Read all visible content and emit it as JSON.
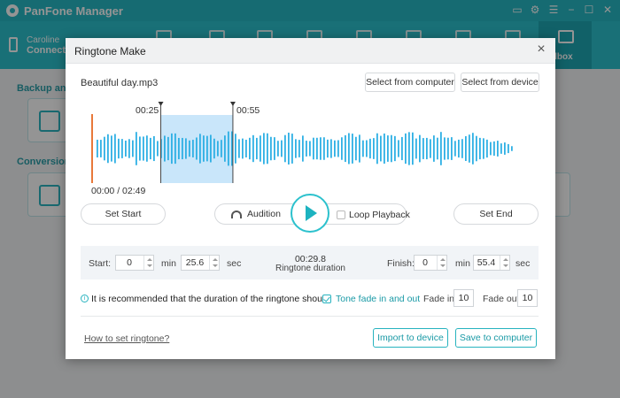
{
  "app": {
    "title": "PanFone Manager",
    "device": {
      "name": "Caroline",
      "status": "Connected"
    },
    "toolbox_label": "olbox",
    "sections": [
      "Backup and r",
      "Conversion t"
    ],
    "accent_color": "#2cc1cd"
  },
  "dialog": {
    "title": "Ringtone Make",
    "file_name": "Beautiful day.mp3",
    "select_from_computer": "Select from computer",
    "select_from_device": "Select from device",
    "selection": {
      "start_time": "00:25",
      "end_time": "00:55",
      "position_label": "00:00 / 02:49",
      "start_fraction": 0.165,
      "end_fraction": 0.336,
      "playhead_fraction": 0.0
    },
    "set_start": "Set Start",
    "set_end": "Set End",
    "audition": "Audition",
    "loop_playback": "Loop Playback",
    "loop_playback_checked": false,
    "start_label": "Start:",
    "finish_label": "Finish:",
    "start_min": "0",
    "start_sec": "25.6",
    "finish_min": "0",
    "finish_sec": "55.4",
    "min_unit": "min",
    "sec_unit": "sec",
    "duration_value": "00:29.8",
    "duration_label": "Ringtone duration",
    "tip": "It is recommended that the duration of the ringtone shou...",
    "tone_fade": "Tone fade in and out",
    "tone_fade_checked": true,
    "fade_in_label": "Fade in",
    "fade_in_value": "10",
    "fade_out_label": "Fade out",
    "fade_out_value": "10",
    "how_to_link": "How to set ringtone?",
    "import_button": "Import to device",
    "save_button": "Save to computer",
    "wave_color": "#2fb0e4",
    "selection_color": "#c9e6fa",
    "playhead_color": "#e8793a"
  }
}
